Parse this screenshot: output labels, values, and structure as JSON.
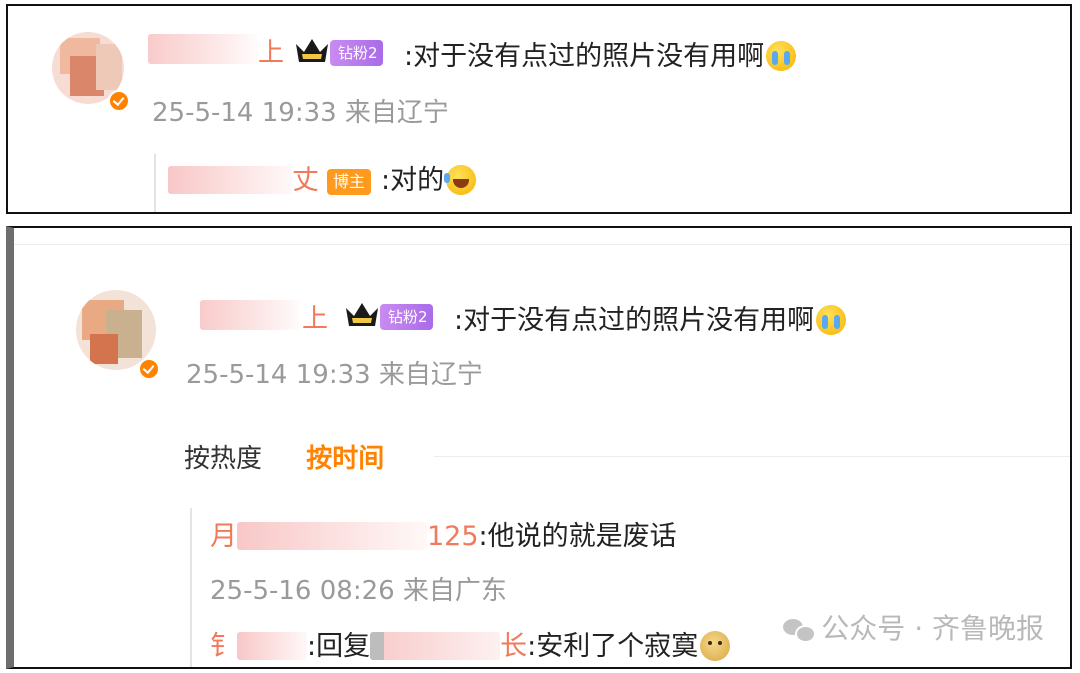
{
  "top_panel": {
    "comment": {
      "name_tail": "上",
      "fan_badge": "钻粉2",
      "text": ":对于没有点过的照片没有用啊",
      "emoji": "cry-emoji",
      "meta": "25-5-14 19:33 来自辽宁"
    },
    "reply": {
      "name_tail": "丈",
      "host_badge": "博主",
      "text": ":对的",
      "emoji": "laugh-cry-emoji"
    }
  },
  "bottom_panel": {
    "comment": {
      "name_tail": "上",
      "fan_badge": "钻粉2",
      "text": ":对于没有点过的照片没有用啊",
      "emoji": "cry-emoji",
      "meta": "25-5-14 19:33 来自辽宁"
    },
    "sort_tabs": {
      "heat": "按热度",
      "time": "按时间"
    },
    "replies": [
      {
        "name_head": "月",
        "name_tail": "125",
        "text": ":他说的就是废话",
        "meta": "25-5-16 08:26 来自广东"
      },
      {
        "name_head": "钅",
        "reply_prefix": ":回复",
        "name_tail": "长",
        "text": ":安利了个寂寞",
        "emoji": "doge-emoji"
      }
    ]
  },
  "watermark": "公众号 · 齐鲁晚报",
  "colors": {
    "accent_orange": "#ff8200",
    "name_red": "#f07a5a",
    "fan_purple": "#a96be8",
    "meta_gray": "#9a9a9a"
  }
}
